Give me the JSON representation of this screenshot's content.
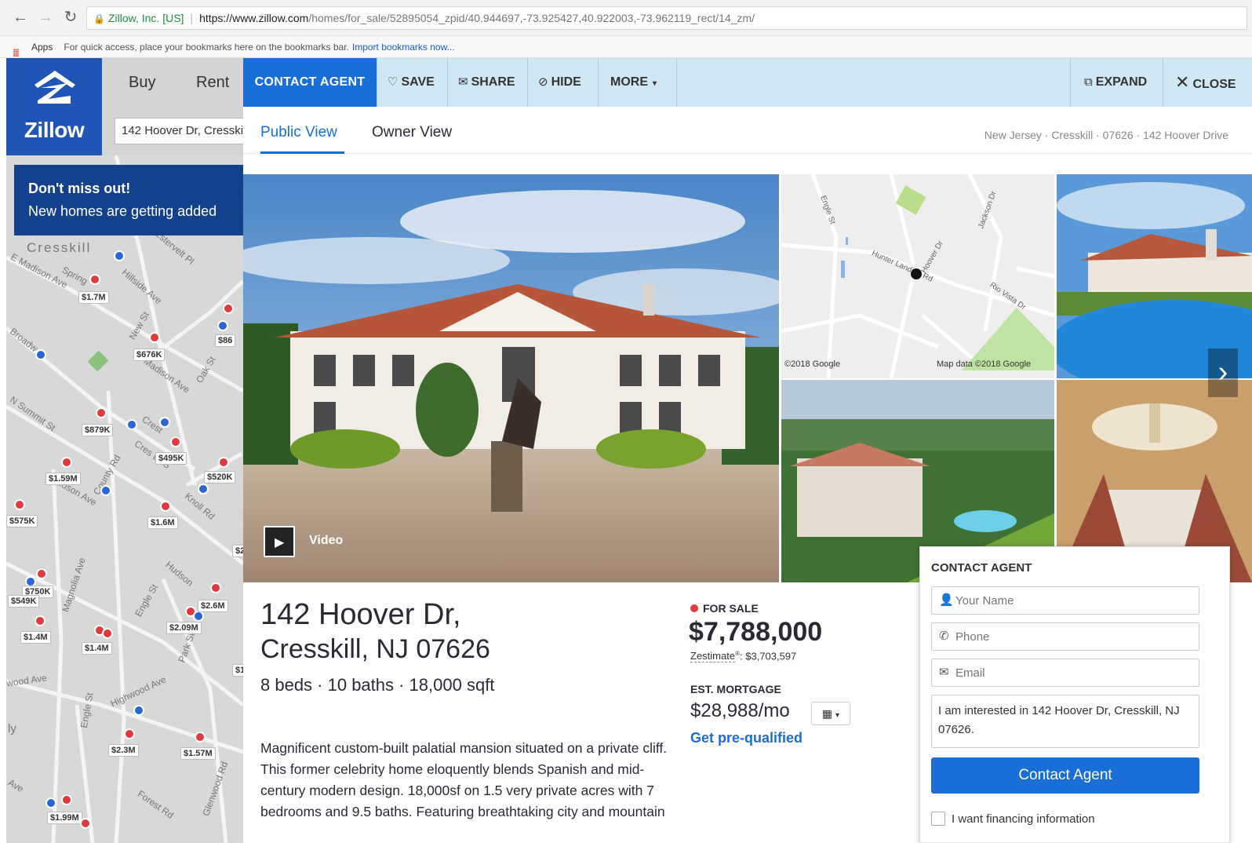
{
  "browser": {
    "secure_name": "Zillow, Inc. [US]",
    "url_host": "https://www.zillow.com",
    "url_path": "/homes/for_sale/52895054_zpid/40.944697,-73.925427,40.922003,-73.962119_rect/14_zm/",
    "bookmarks_apps": "Apps",
    "bookmarks_hint": "For quick access, place your bookmarks here on the bookmarks bar.",
    "bookmarks_link": "Import bookmarks now..."
  },
  "header": {
    "logo_text": "Zillow",
    "nav_buy": "Buy",
    "nav_rent": "Rent",
    "search_value": "142 Hoover Dr, Cresskill, NJ"
  },
  "banner": {
    "title": "Don't miss out!",
    "subtitle": "New homes are getting added"
  },
  "map": {
    "town": "Cresskill",
    "streets": [
      "E Madison Ave",
      "Spring",
      "Hillside Ave",
      "Broadw",
      "New St",
      "N Summit St",
      "Crest",
      "Cres Dr S",
      "Hudson Ave",
      "County Rd",
      "Knoll Rd",
      "Magnolia Ave",
      "Engle St",
      "Hudson",
      "Park St",
      "Highwood Ave",
      "wood Ave",
      "Forest Rd",
      "Glenwood Rd",
      "Ave",
      "ly",
      "Estervelt Pl",
      "E Madison Ave",
      "Oak St",
      "Engle St"
    ],
    "prices": [
      "$1.7M",
      "$676K",
      "$86",
      "$879K",
      "$495K",
      "$1.59M",
      "$520K",
      "$575K",
      "$1.6M",
      "$750K",
      "$549K",
      "$2.6M",
      "$2.09M",
      "$1.4M",
      "$1.4M",
      "$2.3M",
      "$1.57M",
      "$1.99M",
      "$1",
      "$2"
    ]
  },
  "toolbar": {
    "contact_agent": "CONTACT AGENT",
    "save": "SAVE",
    "share": "SHARE",
    "hide": "HIDE",
    "more": "MORE",
    "expand": "EXPAND",
    "close": "CLOSE"
  },
  "tabs": {
    "public": "Public View",
    "owner": "Owner View"
  },
  "breadcrumb": "New Jersey · Cresskill · 07626 · 142 Hoover Drive",
  "gallery": {
    "video_label": "Video",
    "map_credit_left": "©2018 Google",
    "map_credit_right": "Map data ©2018 Google",
    "map_streets": [
      "Engle St",
      "Jackson Dr",
      "Hunter Landing Rd",
      "Hoover Dr",
      "Rio Vista Dr"
    ]
  },
  "listing": {
    "address_line1": "142 Hoover Dr,",
    "address_line2": "Cresskill, NJ 07626",
    "facts": "8 beds · 10 baths · 18,000 sqft",
    "description": "Magnificent custom-built palatial mansion situated on a private cliff. This former celebrity home eloquently blends Spanish and mid-century modern design. 18,000sf on 1.5 very private acres with 7 bedrooms and 9.5 baths. Featuring breathtaking city and mountain",
    "status": "FOR SALE",
    "price": "$7,788,000",
    "zestimate_label": "Zestimate",
    "zestimate_value": ": $3,703,597",
    "mortgage_label": "EST. MORTGAGE",
    "mortgage_value": "$28,988/mo",
    "prequal": "Get pre-qualified"
  },
  "contact_form": {
    "title": "CONTACT AGENT",
    "name_placeholder": "Your Name",
    "phone_placeholder": "Phone",
    "email_placeholder": "Email",
    "message": "I am interested in 142 Hoover Dr, Cresskill, NJ 07626.",
    "submit": "Contact Agent",
    "financing": "I want financing information"
  },
  "colors": {
    "zillow_blue": "#1f56b5",
    "action_blue": "#1a6ed8",
    "toolbar_bg": "#cfe8f4",
    "sale_red": "#e03a3e"
  }
}
